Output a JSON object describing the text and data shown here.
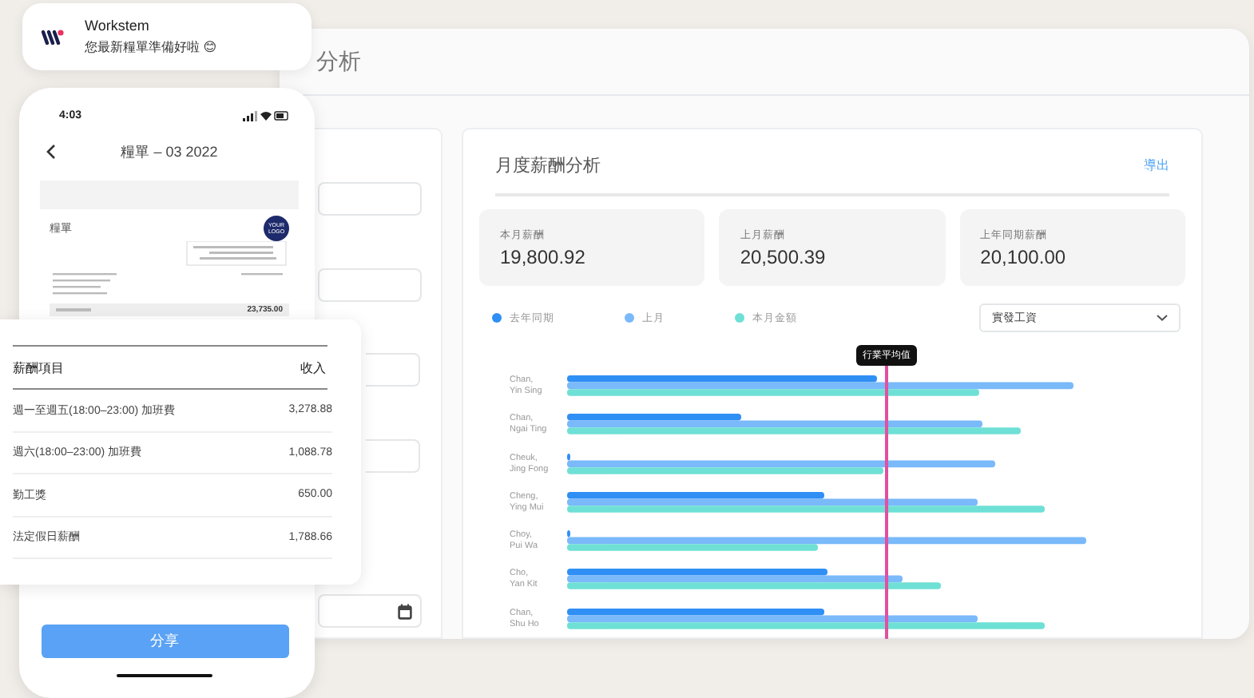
{
  "notification": {
    "app": "Workstem",
    "message": "您最新糧單準備好啦 😊"
  },
  "phone": {
    "time": "4:03",
    "title": "糧單 – 03 2022",
    "payslip": {
      "heading": "糧單",
      "logo": "YOUR LOGO",
      "total": "23,735.00"
    },
    "share_button": "分享"
  },
  "earnings_card": {
    "columns": [
      "薪酬項目",
      "收入"
    ],
    "rows": [
      {
        "item": "週一至週五(18:00–23:00) 加班費",
        "amount": "3,278.88"
      },
      {
        "item": "週六(18:00–23:00) 加班費",
        "amount": "1,088.78"
      },
      {
        "item": "勤工獎",
        "amount": "650.00"
      },
      {
        "item": "法定假日薪酬",
        "amount": "1,788.66"
      }
    ]
  },
  "dashboard": {
    "title": "分析",
    "card": {
      "title": "月度薪酬分析",
      "export_link": "導出",
      "stats": [
        {
          "label": "本月薪酬",
          "value": "19,800.92"
        },
        {
          "label": "上月薪酬",
          "value": "20,500.39"
        },
        {
          "label": "上年同期薪酬",
          "value": "20,100.00"
        }
      ],
      "legend": [
        {
          "label": "去年同期",
          "color": "#2f8ff5"
        },
        {
          "label": "上月",
          "color": "#7ab9fa"
        },
        {
          "label": "本月金額",
          "color": "#6fe0d5"
        }
      ],
      "dropdown": "實發工資",
      "average_label": "行業平均值",
      "employees": [
        {
          "surname": "Chan,",
          "given": "Yin Sing"
        },
        {
          "surname": "Chan,",
          "given": "Ngai Ting"
        },
        {
          "surname": "Cheuk,",
          "given": "Jing Fong"
        },
        {
          "surname": "Cheng,",
          "given": "Ying Mui"
        },
        {
          "surname": "Choy,",
          "given": "Pui Wa"
        },
        {
          "surname": "Cho,",
          "given": "Yan Kit"
        },
        {
          "surname": "Chan,",
          "given": "Shu Ho"
        }
      ]
    }
  }
}
